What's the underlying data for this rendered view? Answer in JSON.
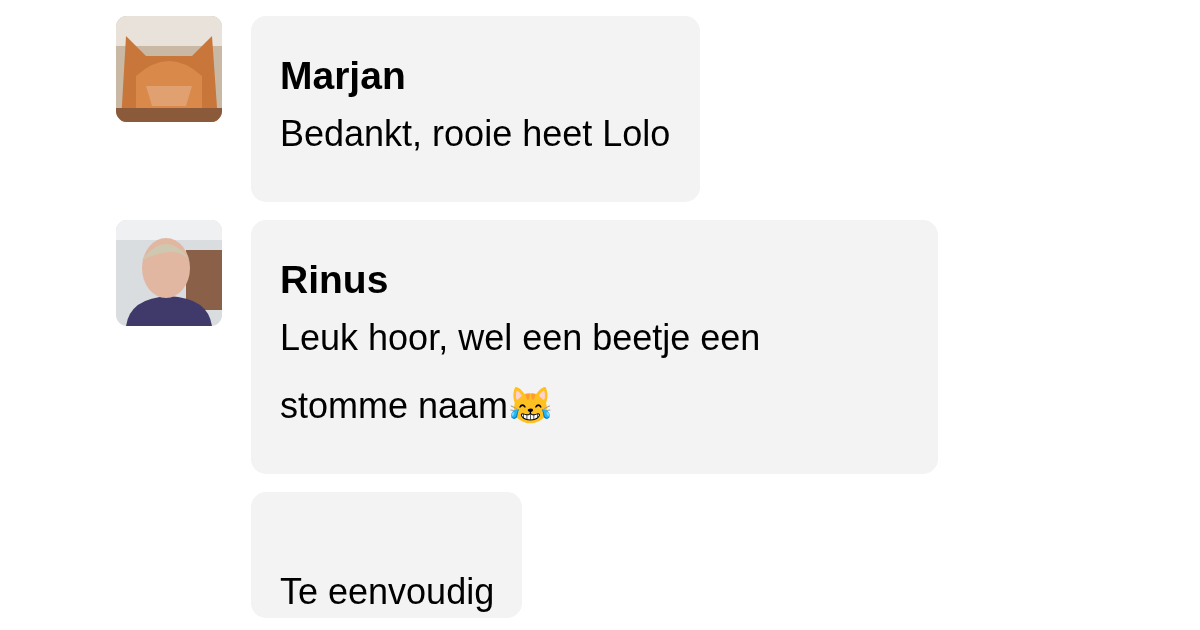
{
  "messages": [
    {
      "avatar": {
        "kind": "picture"
      },
      "sender": "Marjan",
      "lines": [
        "Bedankt, rooie heet Lolo"
      ]
    },
    {
      "avatar": {
        "kind": "picture"
      },
      "sender": "Rinus",
      "lines": [
        "Leuk hoor, wel een beetje een",
        "stomme naam😹"
      ]
    },
    {
      "lines": [
        "Te eenvoudig"
      ]
    }
  ]
}
